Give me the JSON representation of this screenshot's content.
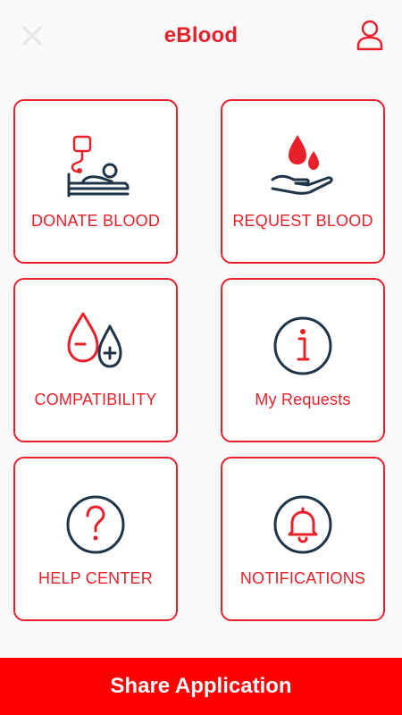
{
  "app": {
    "title": "eBlood"
  },
  "colors": {
    "accent": "#e8202a",
    "icon_dark": "#1f3447",
    "share_bar": "#ff0000"
  },
  "header": {
    "close_icon": "close-icon",
    "profile_icon": "user-icon"
  },
  "tiles": [
    {
      "label": "DONATE BLOOD",
      "icon": "donate-blood-icon"
    },
    {
      "label": "REQUEST BLOOD",
      "icon": "request-blood-icon"
    },
    {
      "label": "COMPATIBILITY",
      "icon": "compatibility-icon"
    },
    {
      "label": "My Requests",
      "icon": "info-icon"
    },
    {
      "label": "HELP CENTER",
      "icon": "question-icon"
    },
    {
      "label": "NOTIFICATIONS",
      "icon": "bell-icon"
    }
  ],
  "footer": {
    "share_label": "Share Application"
  }
}
